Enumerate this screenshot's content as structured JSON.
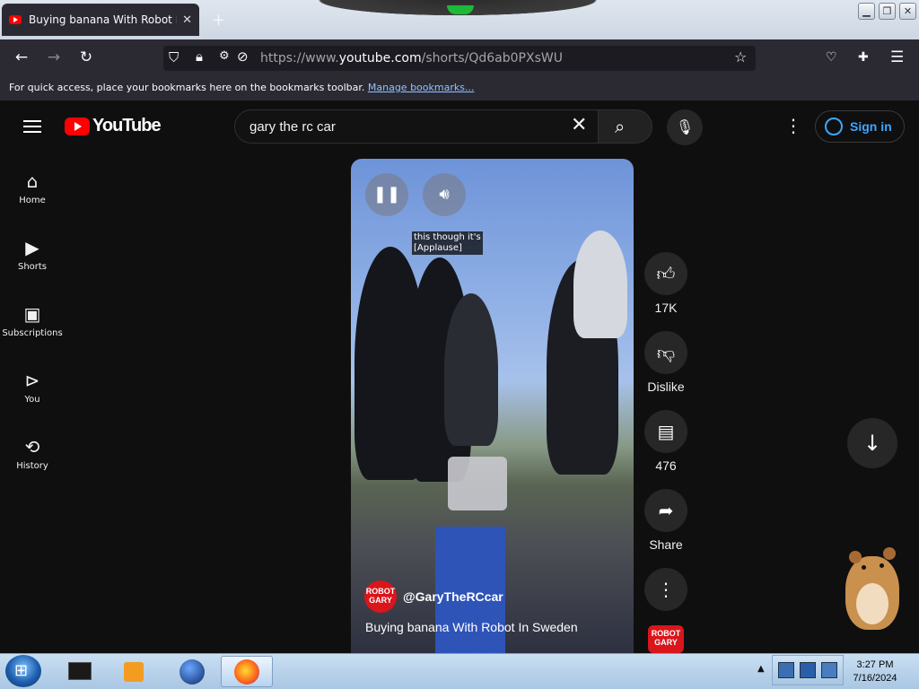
{
  "browser": {
    "tab_title": "Buying banana With Robot In S",
    "tab_close": "✕",
    "new_tab": "+",
    "url_prefix": "https://www.",
    "url_domain": "youtube.com",
    "url_path": "/shorts/Qd6ab0PXsWU",
    "bookmarks_text": "For quick access, place your bookmarks here on the bookmarks toolbar.",
    "bookmarks_link": "Manage bookmarks..."
  },
  "youtube": {
    "logo_text": "YouTube",
    "search_query": "gary the rc car",
    "sign_in": "Sign in",
    "sidebar": [
      {
        "label": "Home",
        "icon": "home-icon"
      },
      {
        "label": "Shorts",
        "icon": "shorts-icon"
      },
      {
        "label": "Subscriptions",
        "icon": "subscriptions-icon"
      },
      {
        "label": "You",
        "icon": "you-icon"
      },
      {
        "label": "History",
        "icon": "history-icon"
      }
    ]
  },
  "video": {
    "caption_line1": "this though it's",
    "caption_line2": "[Applause]",
    "channel_avatar_line1": "ROBOT",
    "channel_avatar_line2": "GARY",
    "channel_handle": "@GaryTheRCcar",
    "title": "Buying banana With Robot In Sweden",
    "likes": "17K",
    "dislike_label": "Dislike",
    "comments": "476",
    "share_label": "Share"
  },
  "taskbar": {
    "time": "3:27 PM",
    "date": "7/16/2024"
  }
}
